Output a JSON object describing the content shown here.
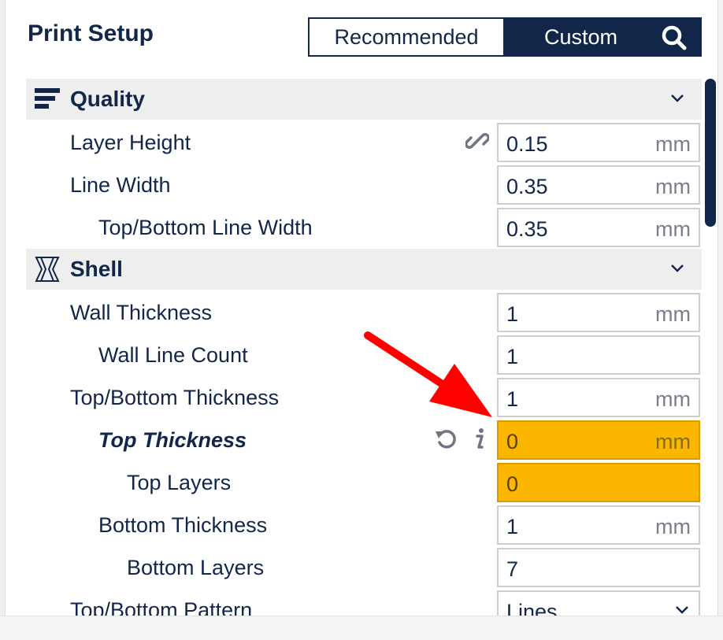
{
  "header": {
    "title": "Print Setup",
    "modes": [
      "Recommended",
      "Custom"
    ],
    "active_mode": "Custom",
    "search_icon": "search-icon"
  },
  "colors": {
    "navy": "#12264a",
    "warning_field": "#fbb600",
    "section_bg": "#eeeeee",
    "arrow": "#ff0000"
  },
  "sections": [
    {
      "label": "Quality",
      "icon": "quality-icon",
      "rows": [
        {
          "label": "Layer Height",
          "value": "0.15",
          "unit": "mm",
          "icon": "link-icon"
        },
        {
          "label": "Line Width",
          "value": "0.35",
          "unit": "mm"
        },
        {
          "label": "Top/Bottom Line Width",
          "value": "0.35",
          "unit": "mm"
        }
      ]
    },
    {
      "label": "Shell",
      "icon": "shell-icon",
      "rows": [
        {
          "label": "Wall Thickness",
          "value": "1",
          "unit": "mm"
        },
        {
          "label": "Wall Line Count",
          "value": "1",
          "unit": ""
        },
        {
          "label": "Top/Bottom Thickness",
          "value": "1",
          "unit": "mm"
        },
        {
          "label": "Top Thickness",
          "value": "0",
          "unit": "mm",
          "icons": [
            "reset-icon",
            "info-icon"
          ]
        },
        {
          "label": "Top Layers",
          "value": "0",
          "unit": ""
        },
        {
          "label": "Bottom Thickness",
          "value": "1",
          "unit": "mm"
        },
        {
          "label": "Bottom Layers",
          "value": "7",
          "unit": ""
        },
        {
          "label": "Top/Bottom Pattern",
          "value": "Lines",
          "unit": ""
        }
      ]
    }
  ]
}
